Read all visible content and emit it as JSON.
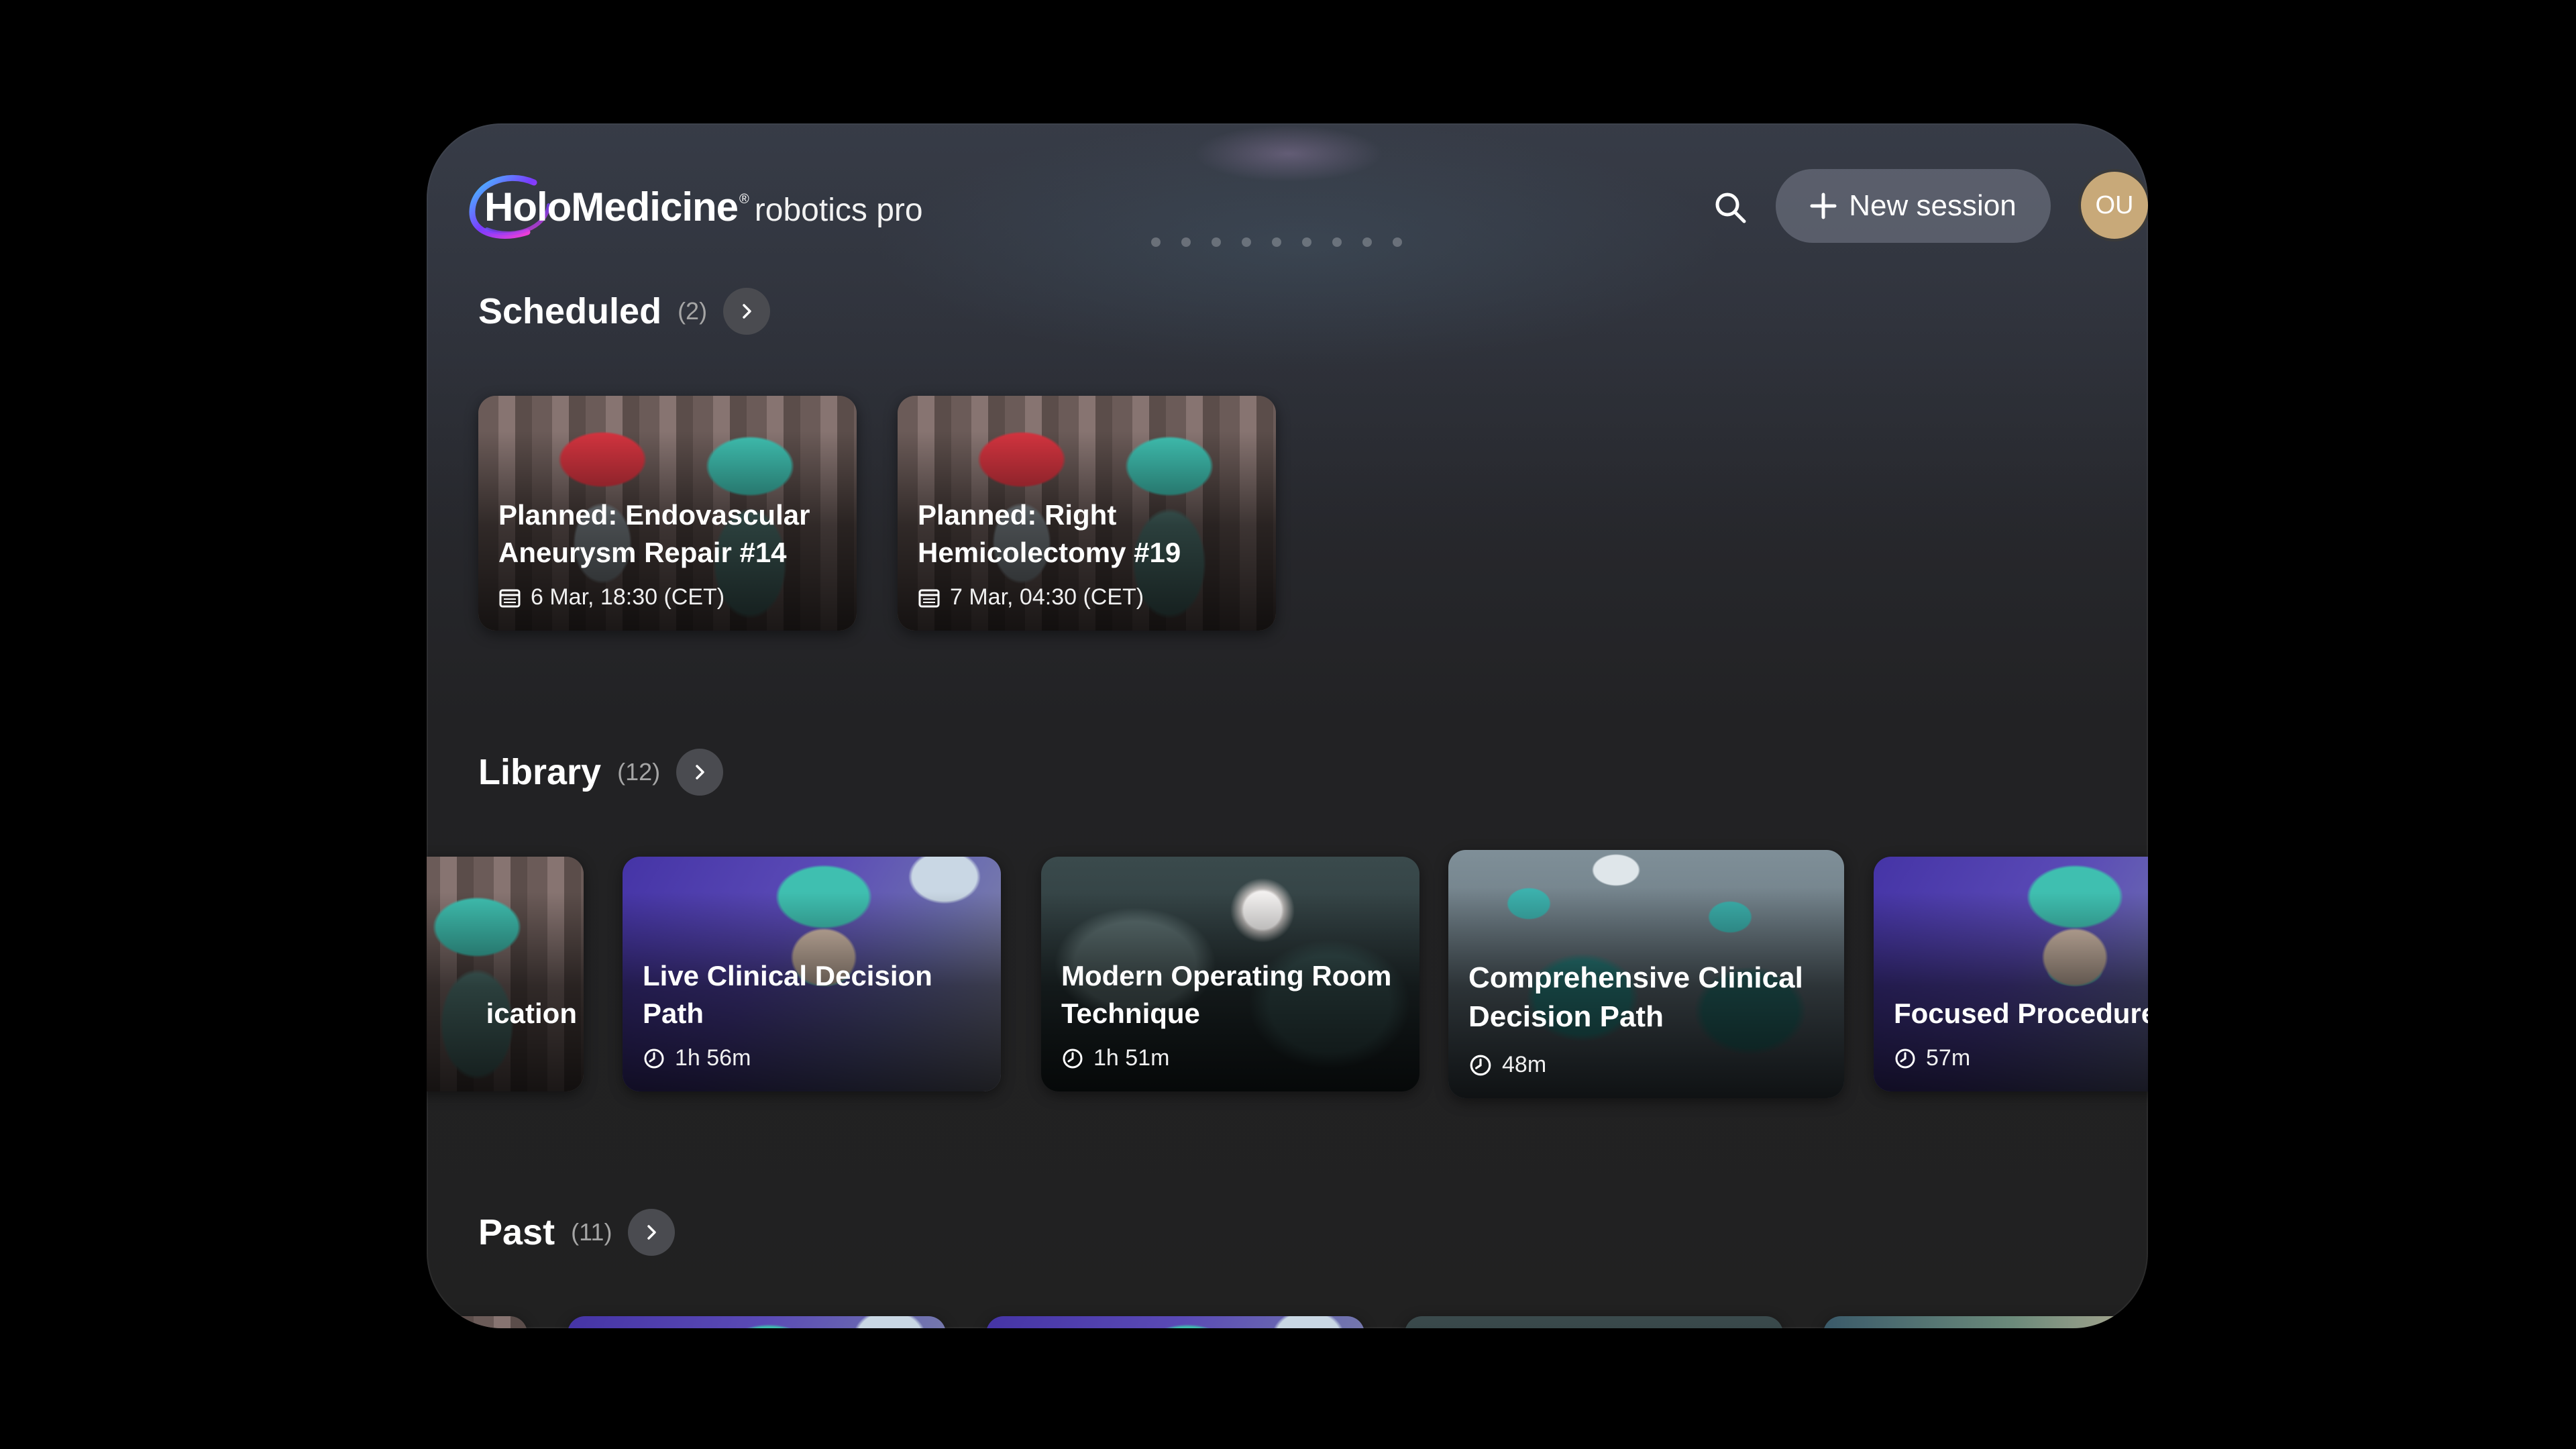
{
  "app": {
    "brand": "HoloMedicine",
    "registered": "®",
    "subtitle": "robotics pro"
  },
  "header": {
    "search_icon": "search-icon",
    "new_session_label": "New session",
    "avatar_initials": "OU"
  },
  "sections": {
    "scheduled": {
      "title": "Scheduled",
      "count": "(2)",
      "cards": [
        {
          "title": "Planned: Endovascular Aneurysm Repair #14",
          "meta": "6 Mar, 18:30 (CET)",
          "icon": "calendar-icon"
        },
        {
          "title": "Planned: Right Hemicolectomy #19",
          "meta": "7 Mar, 04:30 (CET)",
          "icon": "calendar-icon"
        }
      ]
    },
    "library": {
      "title": "Library",
      "count": "(12)",
      "cards": [
        {
          "title": "ication",
          "meta": "",
          "icon": "clock-icon"
        },
        {
          "title": "Live Clinical Decision Path",
          "meta": "1h 56m",
          "icon": "clock-icon"
        },
        {
          "title": "Modern Operating Room Technique",
          "meta": "1h 51m",
          "icon": "clock-icon"
        },
        {
          "title": "Comprehensive Clinical Decision Path",
          "meta": "48m",
          "icon": "clock-icon"
        },
        {
          "title": "Focused Procedure Walkthrough",
          "meta": "57m",
          "icon": "clock-icon"
        }
      ]
    },
    "past": {
      "title": "Past",
      "count": "(11)"
    }
  },
  "colors": {
    "page_background": "#000000",
    "window_background": "#212121",
    "button_fill": "#6f7480",
    "avatar_fill": "#c8a979",
    "logo_gradient": [
      "#3fd0ff",
      "#7a3cff",
      "#ff3fd0"
    ]
  }
}
